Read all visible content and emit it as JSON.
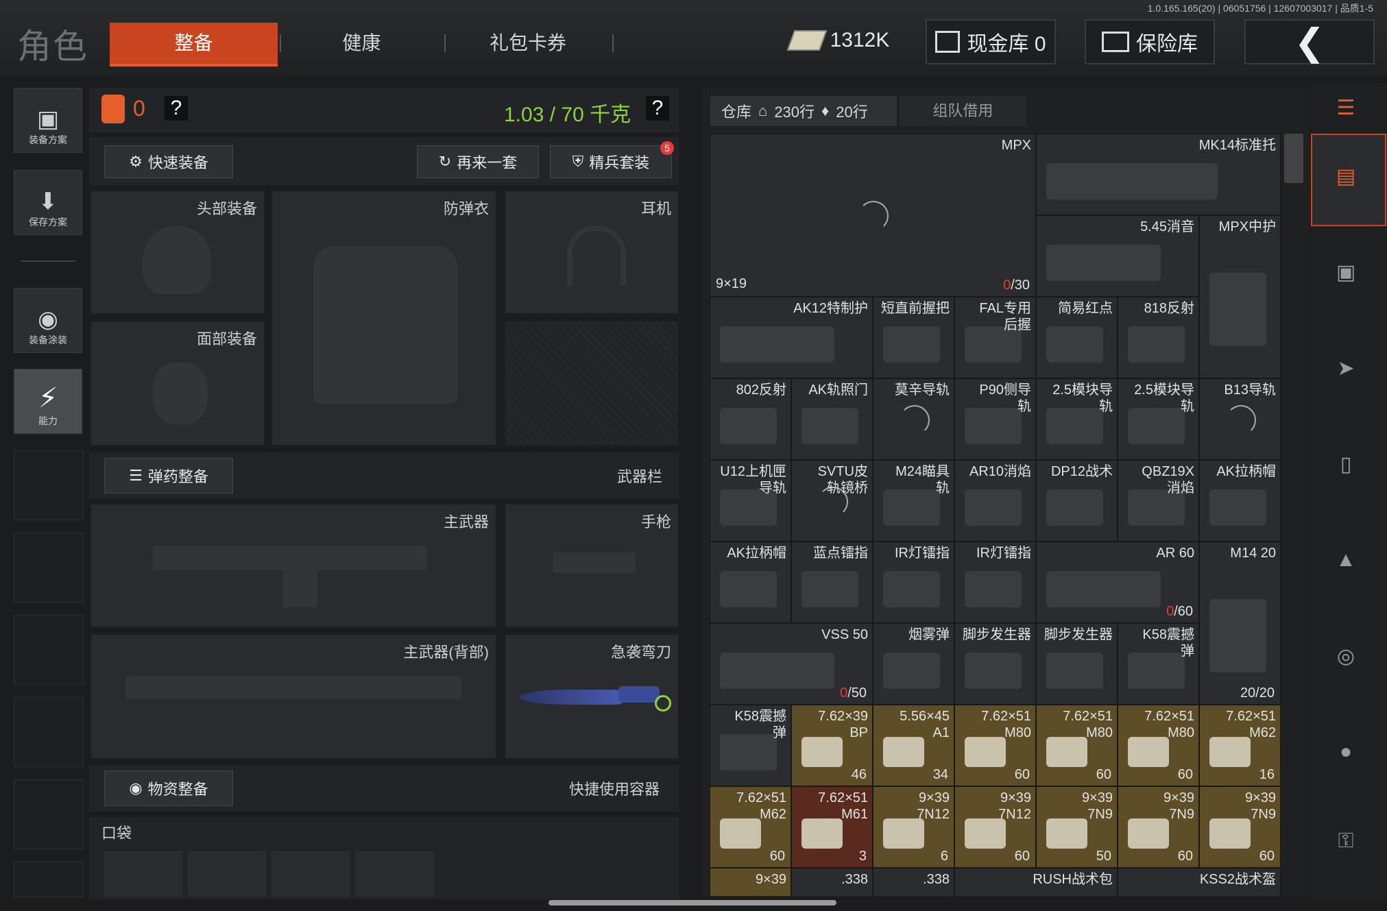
{
  "version_text": "1.0.165.165(20) | 06051756 | 12607003017 | 品质1-5",
  "page_title": "角色",
  "tabs": [
    {
      "label": "整备",
      "active": true
    },
    {
      "label": "健康",
      "active": false
    },
    {
      "label": "礼包卡券",
      "active": false
    }
  ],
  "header": {
    "money": "1312K",
    "cash_box": "现金库 0",
    "safe_box": "保险库"
  },
  "sidebar": {
    "items": [
      {
        "label": "装备方案",
        "icon": "vest-icon"
      },
      {
        "label": "保存方案",
        "icon": "download-icon"
      },
      {
        "label": "装备涂装",
        "icon": "helmet-paint-icon"
      },
      {
        "label": "能力",
        "icon": "lightning-icon"
      }
    ]
  },
  "loadout": {
    "backpack_count": "0",
    "weight": "1.03 / 70 千克",
    "quick_equip": "快速装备",
    "again": "再来一套",
    "elite": "精兵套装",
    "elite_badge": "5",
    "slots": {
      "head": "头部装备",
      "armor": "防弹衣",
      "headset": "耳机",
      "face": "面部装备"
    },
    "ammo_equip": "弹药整备",
    "weapon_bar": "武器栏",
    "primary": "主武器",
    "pistol": "手枪",
    "primary_back": "主武器(背部)",
    "melee": "急袭弯刀",
    "supply_equip": "物资整备",
    "quick_container": "快捷使用容器",
    "pocket": "口袋"
  },
  "warehouse": {
    "tab_label": "仓库",
    "rows": "230行",
    "rows2": "20行",
    "team_borrow": "组队借用"
  },
  "grid_items": [
    {
      "name": "MPX",
      "foot": "9×19",
      "count_red": "0",
      "count": "/30"
    },
    {
      "name": "MK14标准托"
    },
    {
      "name": "5.45消音"
    },
    {
      "name": "MPX中护"
    },
    {
      "name": "AK12特制护"
    },
    {
      "name": "短直前握把"
    },
    {
      "name": "FAL专用\n后握"
    },
    {
      "name": "简易红点"
    },
    {
      "name": "818反射"
    },
    {
      "name": "802反射"
    },
    {
      "name": "AK轨照门"
    },
    {
      "name": "莫辛导轨"
    },
    {
      "name": "P90侧导\n轨"
    },
    {
      "name": "2.5模块导\n轨"
    },
    {
      "name": "2.5模块导\n轨"
    },
    {
      "name": "B13导轨"
    },
    {
      "name": "U12上机匣\n导轨"
    },
    {
      "name": "SVTU皮\n轨镜桥"
    },
    {
      "name": "M24瞄具\n轨"
    },
    {
      "name": "AR10消焰"
    },
    {
      "name": "DP12战术"
    },
    {
      "name": "QBZ19X\n消焰"
    },
    {
      "name": "AK拉柄帽"
    },
    {
      "name": "AK拉柄帽"
    },
    {
      "name": "蓝点镭指"
    },
    {
      "name": "IR灯镭指"
    },
    {
      "name": "IR灯镭指"
    },
    {
      "name": "AR 60",
      "count_red": "0",
      "count": "/60"
    },
    {
      "name": "M14 20",
      "count": "20/20"
    },
    {
      "name": "VSS 50",
      "count_red": "0",
      "count": "/50"
    },
    {
      "name": "烟雾弹"
    },
    {
      "name": "脚步发生器"
    },
    {
      "name": "脚步发生器"
    },
    {
      "name": "K58震撼\n弹"
    },
    {
      "name": "K58震撼\n弹"
    },
    {
      "name": "7.62×39\nBP",
      "count": "46"
    },
    {
      "name": "5.56×45\nA1",
      "count": "34"
    },
    {
      "name": "7.62×51\nM80",
      "count": "60"
    },
    {
      "name": "7.62×51\nM80",
      "count": "60"
    },
    {
      "name": "7.62×51\nM80",
      "count": "60"
    },
    {
      "name": "7.62×51\nM62",
      "count": "16"
    },
    {
      "name": "7.62×51\nM62",
      "count": "60"
    },
    {
      "name": "7.62×51\nM61",
      "count": "3"
    },
    {
      "name": "9×39\n7N12",
      "count": "6"
    },
    {
      "name": "9×39\n7N12",
      "count": "60"
    },
    {
      "name": "9×39\n7N9",
      "count": "50"
    },
    {
      "name": "9×39\n7N9",
      "count": "60"
    },
    {
      "name": "9×39\n7N9",
      "count": "60"
    },
    {
      "name": "9×39"
    },
    {
      "name": ".338"
    },
    {
      "name": ".338"
    },
    {
      "name": "RUSH战术包"
    },
    {
      "name": "KSS2战术盔"
    }
  ],
  "colors": {
    "accent": "#c9451f",
    "weight_green": "#8fd33b",
    "ammo_bg": "#5d4e27",
    "count_red": "#e53b3b"
  }
}
